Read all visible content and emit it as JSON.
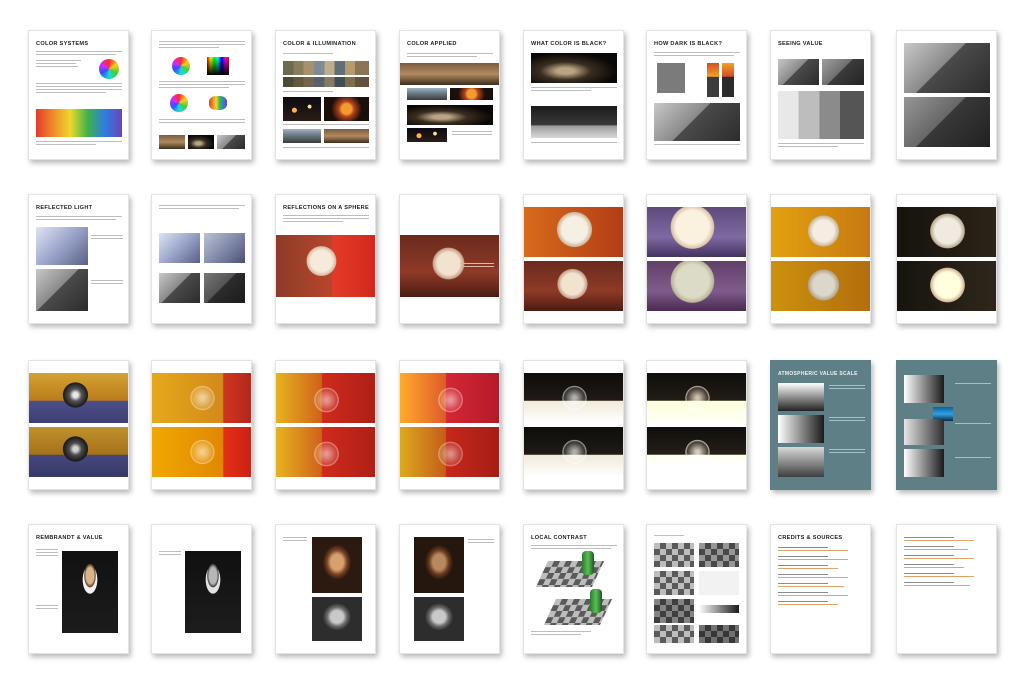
{
  "pages": [
    {
      "id": "p1",
      "title": "COLOR SYSTEMS",
      "label": "Page: Color Systems"
    },
    {
      "id": "p2",
      "title": "",
      "label": "Page: Color Models"
    },
    {
      "id": "p3",
      "title": "COLOR & ILLUMINATION",
      "label": "Page: Color & Illumination"
    },
    {
      "id": "p4",
      "title": "COLOR APPLIED",
      "label": "Page: Color Applied"
    },
    {
      "id": "p5",
      "title": "WHAT COLOR IS BLACK?",
      "label": "Page: What Color Is Black?"
    },
    {
      "id": "p6",
      "title": "HOW DARK IS BLACK?",
      "label": "Page: How Dark Is Black?"
    },
    {
      "id": "p7",
      "title": "SEEING VALUE",
      "label": "Page: Seeing Value"
    },
    {
      "id": "p8",
      "title": "",
      "label": "Page: Value Studies"
    },
    {
      "id": "p9",
      "title": "REFLECTED LIGHT",
      "label": "Page: Reflected Light"
    },
    {
      "id": "p10",
      "title": "",
      "label": "Page: Reflected Light Cubes"
    },
    {
      "id": "p11",
      "title": "REFLECTIONS ON A SPHERE",
      "label": "Page: Reflections on a Sphere"
    },
    {
      "id": "p12",
      "title": "",
      "label": "Page: Sphere Red Wall"
    },
    {
      "id": "p13",
      "title": "",
      "label": "Page: Sphere Orange Red"
    },
    {
      "id": "p14",
      "title": "",
      "label": "Page: Sphere Purple"
    },
    {
      "id": "p15",
      "title": "",
      "label": "Page: Sphere Yellow"
    },
    {
      "id": "p16",
      "title": "",
      "label": "Page: Sphere Dark"
    },
    {
      "id": "p17",
      "title": "",
      "label": "Page: Chrome Ball"
    },
    {
      "id": "p18",
      "title": "",
      "label": "Page: Glass Sphere Orange"
    },
    {
      "id": "p19",
      "title": "",
      "label": "Page: Glass Sphere Red"
    },
    {
      "id": "p20",
      "title": "",
      "label": "Page: Glass Sphere Red Wall"
    },
    {
      "id": "p21",
      "title": "",
      "label": "Page: Glass Sphere Dark"
    },
    {
      "id": "p22",
      "title": "",
      "label": "Page: Glass Sphere Cream"
    },
    {
      "id": "p23",
      "title": "ATMOSPHERIC VALUE SCALE",
      "label": "Page: Atmospheric Value Scale"
    },
    {
      "id": "p24",
      "title": "",
      "label": "Page: Atmospheric Examples"
    },
    {
      "id": "p25",
      "title": "REMBRANDT & VALUE",
      "label": "Page: Rembrandt & Value"
    },
    {
      "id": "p26",
      "title": "",
      "label": "Page: Value Percentages"
    },
    {
      "id": "p27",
      "title": "",
      "label": "Page: Rembrandt Self Portrait 1"
    },
    {
      "id": "p28",
      "title": "",
      "label": "Page: Rembrandt Self Portrait 2"
    },
    {
      "id": "p29",
      "title": "LOCAL CONTRAST",
      "label": "Page: Local Contrast"
    },
    {
      "id": "p30",
      "title": "",
      "label": "Page: Contrast Experiments"
    },
    {
      "id": "p31",
      "title": "CREDITS & SOURCES",
      "label": "Page: Credits & Sources"
    },
    {
      "id": "p32",
      "title": "",
      "label": "Page: Sources Continued"
    }
  ],
  "colors": {
    "page_bg": "#ffffff",
    "atmospheric_bg": "#5f7f86"
  }
}
